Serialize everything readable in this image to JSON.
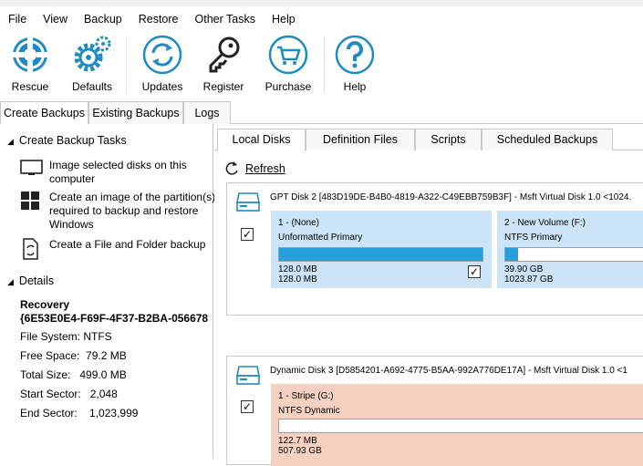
{
  "menu": [
    "File",
    "View",
    "Backup",
    "Restore",
    "Other Tasks",
    "Help"
  ],
  "toolbar": {
    "rescue": "Rescue",
    "defaults": "Defaults",
    "updates": "Updates",
    "register": "Register",
    "purchase": "Purchase",
    "help": "Help"
  },
  "colors": {
    "accent": "#1e8bc3",
    "bar_fill": "#26a0da",
    "partition_selected": "#cce4f7",
    "partition_dynamic": "#f6d1c0"
  },
  "main_tabs": [
    "Create Backups",
    "Existing Backups",
    "Logs"
  ],
  "left": {
    "tasks_header": "Create Backup Tasks",
    "tasks": [
      {
        "icon": "monitor-icon",
        "text": "Image selected disks on this computer"
      },
      {
        "icon": "windows-logo-icon",
        "text": "Create an image of the partition(s) required to backup and restore Windows"
      },
      {
        "icon": "file-backup-icon",
        "text": "Create a File and Folder backup"
      }
    ],
    "details_header": "Details",
    "details": {
      "name": "Recovery",
      "guid": "{6E53E0E4-F69F-4F37-B2BA-056678",
      "file_system": "File System: NTFS",
      "free_space_label": "Free Space:",
      "free_space": "79.2 MB",
      "total_size_label": "Total Size:",
      "total_size": "499.0 MB",
      "start_sector_label": "Start Sector:",
      "start_sector": "2,048",
      "end_sector_label": "End Sector:",
      "end_sector": "1,023,999"
    }
  },
  "sub_tabs": [
    "Local Disks",
    "Definition Files",
    "Scripts",
    "Scheduled Backups"
  ],
  "refresh": "Refresh",
  "disks": [
    {
      "header": "GPT Disk 2 [483D19DE-B4B0-4819-A322-C49EBB759B3F] - Msft    Virtual Disk    1.0  <1024.",
      "checked": true,
      "partitions": [
        {
          "title": "1 -  (None)",
          "type": "Unformatted Primary",
          "used": 1.0,
          "size1": "128.0 MB",
          "size2": "128.0 MB",
          "checked": true
        },
        {
          "title": "2 - New Volume (F:)",
          "type": "NTFS Primary",
          "used": 0.04,
          "size1": "39.90 GB",
          "size2": "1023.87 GB",
          "checked": false
        }
      ]
    },
    {
      "header": "Dynamic Disk 3 [D5854201-A692-4775-B5AA-992A776DE17A] - Msft    Virtual Disk    1.0  <1",
      "checked": true,
      "partitions": [
        {
          "title": "1 - Stripe (G:)",
          "type": "NTFS Dynamic",
          "used": 0.0,
          "size1": "122.7 MB",
          "size2": "507.93 GB"
        }
      ]
    }
  ]
}
